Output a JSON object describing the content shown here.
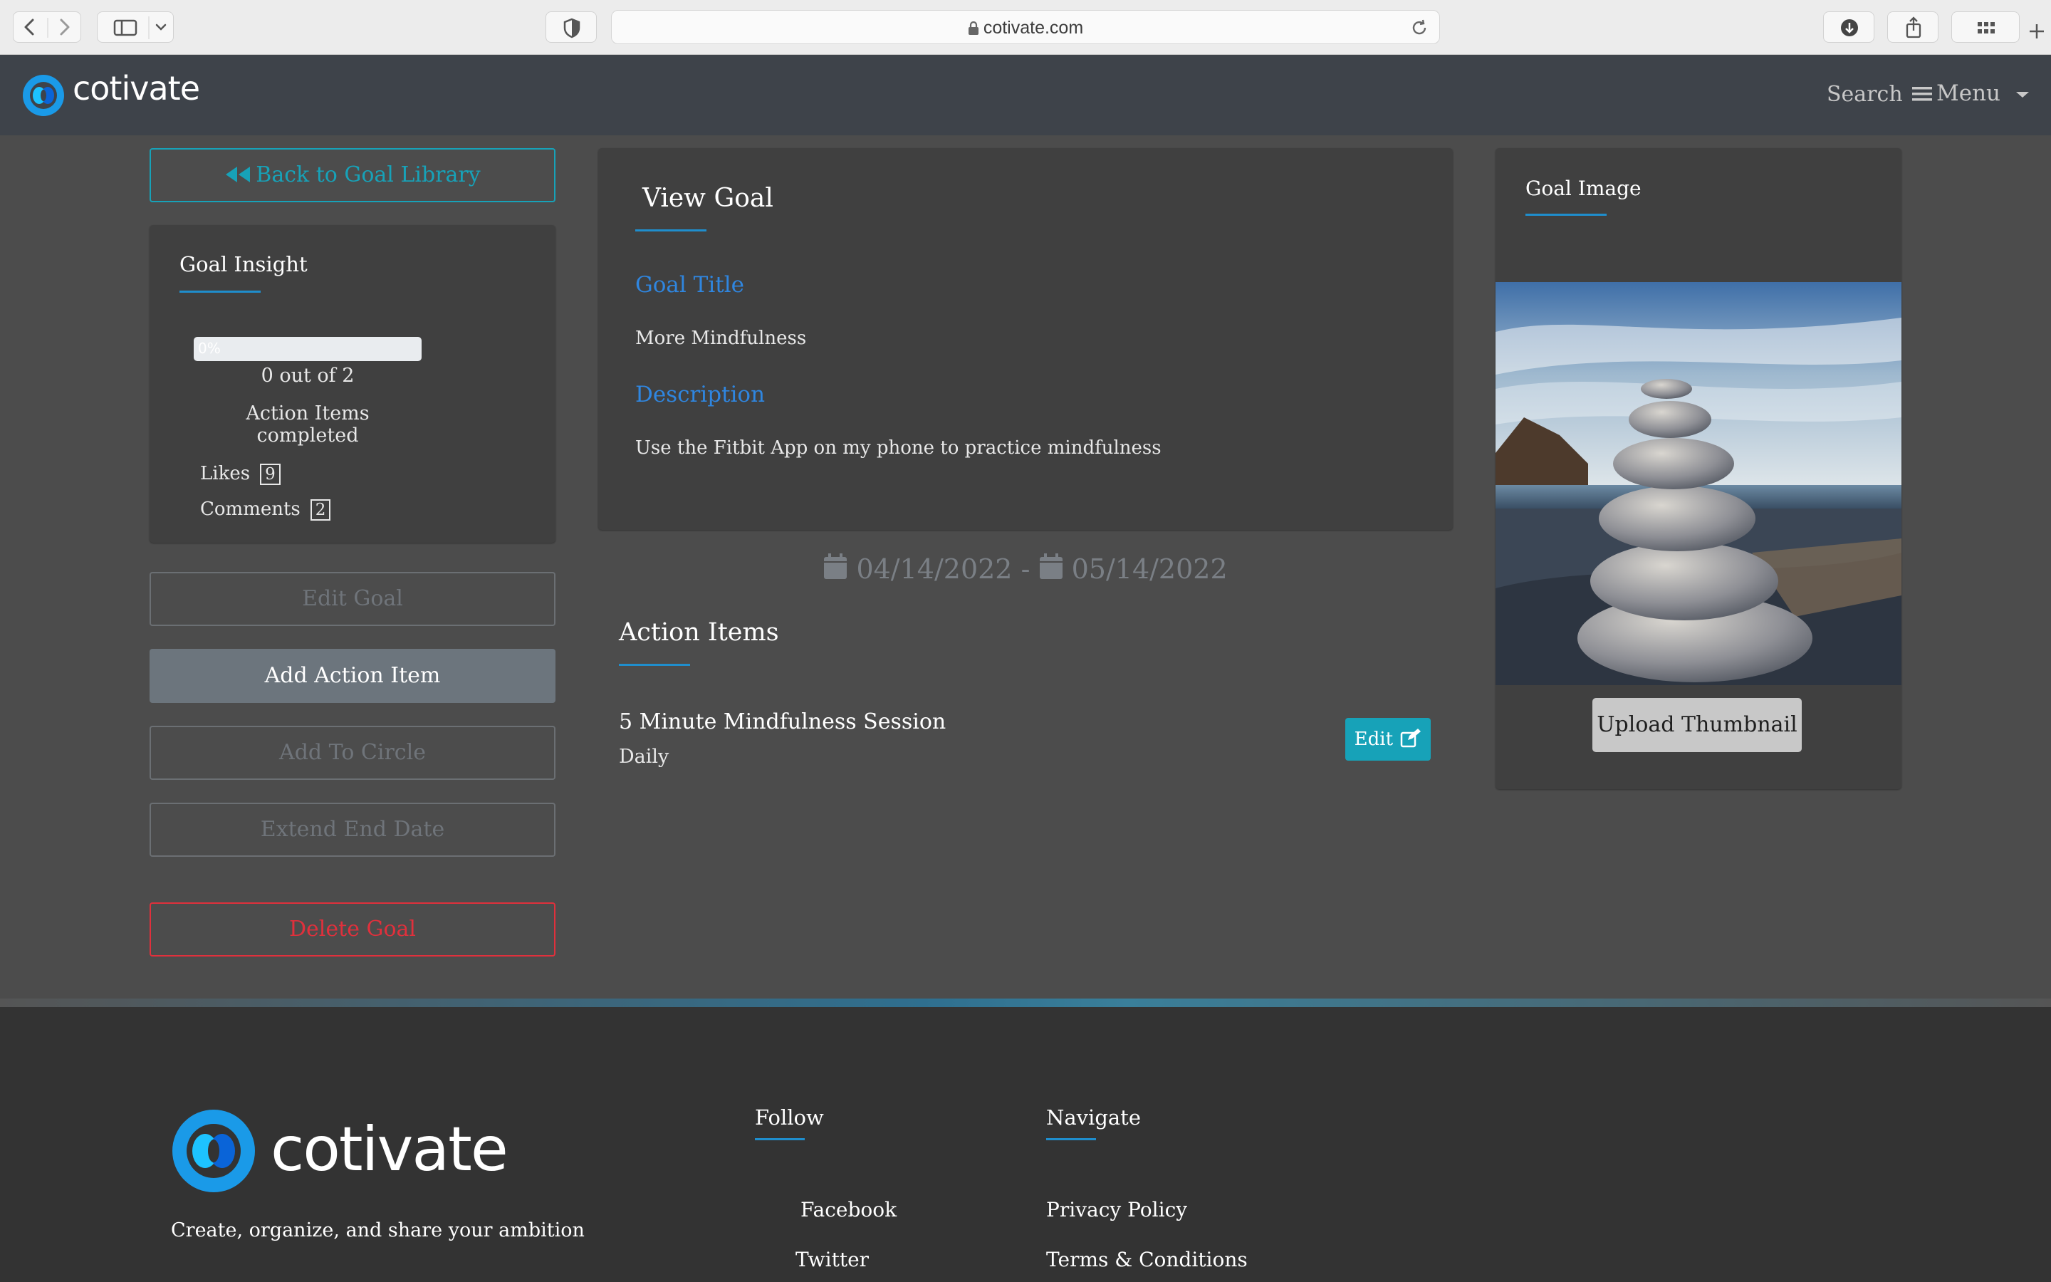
{
  "browser": {
    "url": "cotivate.com"
  },
  "header": {
    "brand": "cotivate",
    "search_label": "Search",
    "menu_label": "Menu"
  },
  "sidebar": {
    "back_label": "Back to Goal Library",
    "insight_title": "Goal Insight",
    "progress_percent": 0,
    "progress_text": "0%",
    "completed_count": "0 out of 2",
    "completed_label": "Action Items completed",
    "likes_label": "Likes",
    "likes_count": "9",
    "comments_label": "Comments",
    "comments_count": "2",
    "edit_goal_label": "Edit Goal",
    "add_action_item_label": "Add Action Item",
    "add_to_circle_label": "Add To Circle",
    "extend_end_date_label": "Extend End Date",
    "delete_goal_label": "Delete Goal"
  },
  "main": {
    "view_goal_title": "View Goal",
    "goal_title_label": "Goal Title",
    "goal_title_value": "More Mindfulness",
    "description_label": "Description",
    "description_value": "Use the Fitbit App on my phone to practice mindfulness",
    "start_date": "04/14/2022",
    "date_separator": "-",
    "end_date": "05/14/2022",
    "action_items_title": "Action Items",
    "action_items": [
      {
        "name": "5 Minute Mindfulness Session",
        "frequency": "Daily",
        "edit_label": "Edit"
      }
    ]
  },
  "image_panel": {
    "title": "Goal Image",
    "upload_label": "Upload Thumbnail"
  },
  "footer": {
    "brand": "cotivate",
    "tagline": "Create, organize, and share your ambition",
    "follow_title": "Follow",
    "follow_links": [
      "Facebook",
      "Twitter"
    ],
    "navigate_title": "Navigate",
    "navigate_links": [
      "Privacy Policy",
      "Terms & Conditions"
    ]
  },
  "colors": {
    "accent": "#1f8ecd",
    "link_blue": "#2f86e0",
    "teal": "#17a2b8",
    "danger": "#e0303c",
    "header_bg": "#3e434a",
    "footer_bg": "#333333"
  }
}
